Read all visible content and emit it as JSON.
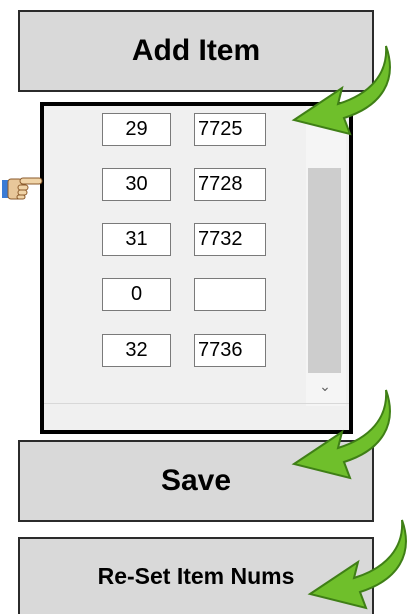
{
  "buttons": {
    "add": "Add Item",
    "save": "Save",
    "reset": "Re-Set Item Nums"
  },
  "rows": [
    {
      "num": "29",
      "val": "7725"
    },
    {
      "num": "30",
      "val": "7728"
    },
    {
      "num": "31",
      "val": "7732"
    },
    {
      "num": "0",
      "val": ""
    },
    {
      "num": "32",
      "val": "7736"
    }
  ],
  "icons": {
    "pointer": "pointing-hand-icon",
    "arrow": "green-arrow-icon",
    "scroll_down": "chevron-down-icon"
  },
  "colors": {
    "button_bg": "#d9d9d9",
    "arrow_green": "#6fbf2b",
    "panel_border": "#000000"
  }
}
